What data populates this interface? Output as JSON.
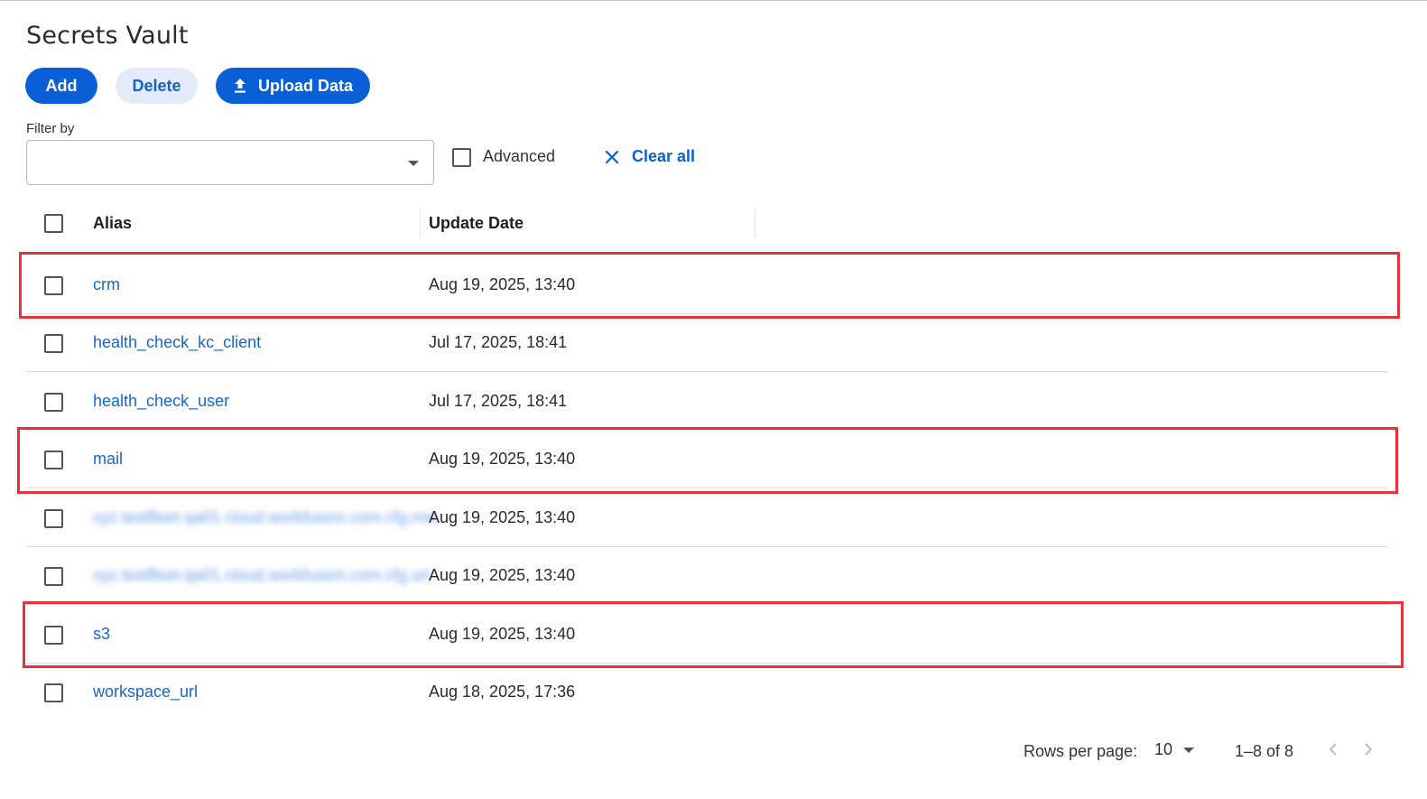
{
  "page": {
    "title": "Secrets Vault"
  },
  "toolbar": {
    "add_label": "Add",
    "delete_label": "Delete",
    "upload_label": "Upload Data",
    "upload_icon": "upload-icon"
  },
  "filter": {
    "label": "Filter by",
    "value": "",
    "advanced_label": "Advanced",
    "advanced_checked": false,
    "clear_all_label": "Clear all",
    "clear_icon": "close-icon"
  },
  "table": {
    "columns": {
      "alias": "Alias",
      "update_date": "Update Date"
    },
    "rows": [
      {
        "alias": "crm",
        "update_date": "Aug 19, 2025, 13:40",
        "highlighted": true,
        "blurred": false
      },
      {
        "alias": "health_check_kc_client",
        "update_date": "Jul 17, 2025, 18:41",
        "highlighted": false,
        "blurred": false
      },
      {
        "alias": "health_check_user",
        "update_date": "Jul 17, 2025, 18:41",
        "highlighted": false,
        "blurred": false
      },
      {
        "alias": "mail",
        "update_date": "Aug 19, 2025, 13:40",
        "highlighted": true,
        "blurred": false
      },
      {
        "alias": "",
        "update_date": "Aug 19, 2025, 13:40",
        "highlighted": false,
        "blurred": true
      },
      {
        "alias": "",
        "update_date": "Aug 19, 2025, 13:40",
        "highlighted": false,
        "blurred": true
      },
      {
        "alias": "s3",
        "update_date": "Aug 19, 2025, 13:40",
        "highlighted": true,
        "blurred": false
      },
      {
        "alias": "workspace_url",
        "update_date": "Aug 18, 2025, 17:36",
        "highlighted": false,
        "blurred": false
      }
    ]
  },
  "pagination": {
    "rows_per_page_label": "Rows per page:",
    "rows_per_page_value": "10",
    "range_label": "1–8 of 8"
  },
  "colors": {
    "primary": "#0b5fd6",
    "link": "#1a66cc",
    "highlight": "#e5323f",
    "secondary_button_bg": "#e3ecf8"
  }
}
